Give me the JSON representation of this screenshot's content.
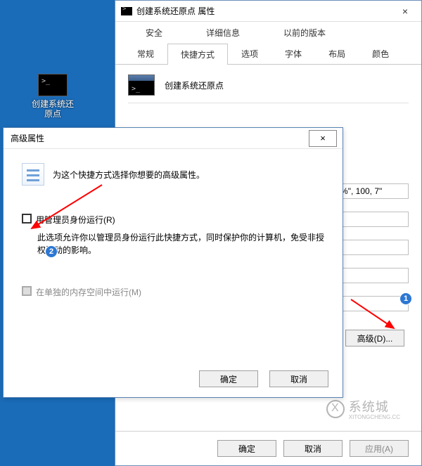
{
  "desktop": {
    "icon_label": "创建系统还\n原点"
  },
  "props_window": {
    "title": "创建系统还原点 属性",
    "close": "×",
    "tabs_row1": [
      "安全",
      "详细信息",
      "以前的版本"
    ],
    "tabs_row2": [
      "常规",
      "快捷方式",
      "选项",
      "字体",
      "布局",
      "颜色"
    ],
    "active_tab": "快捷方式",
    "app_name": "创建系统还原点",
    "visible_target_value": "\"%DATE%\", 100, 7\"",
    "advanced_button": "高级(D)...",
    "ok": "确定",
    "cancel": "取消",
    "apply": "应用(A)"
  },
  "adv_dialog": {
    "title": "高级属性",
    "close": "×",
    "header_text": "为这个快捷方式选择你想要的高级属性。",
    "run_as_admin_label": "用管理员身份运行(R)",
    "run_as_admin_checked": false,
    "run_as_admin_desc": "此选项允许你以管理员身份运行此快捷方式，同时保护你的计算机，免受非授权活动的影响。",
    "sep_mem_label": "在单独的内存空间中运行(M)",
    "sep_mem_checked": true,
    "sep_mem_disabled": true,
    "ok": "确定",
    "cancel": "取消"
  },
  "annotations": {
    "badge1": "1",
    "badge2": "2",
    "arrow_color": "#ff0000"
  },
  "watermark": {
    "text": "系统城",
    "sub": "XITONGCHENG.CC"
  }
}
